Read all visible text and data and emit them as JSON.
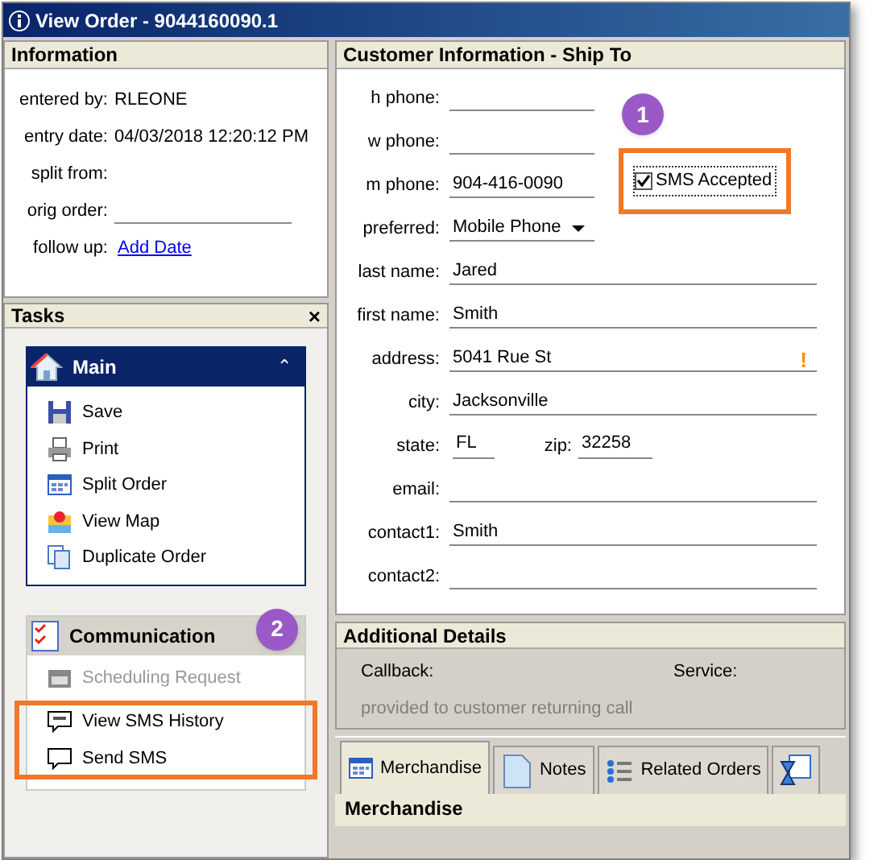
{
  "window": {
    "title": "View Order - 9044160090.1"
  },
  "information": {
    "title": "Information",
    "rows": [
      {
        "label": "entered by:",
        "value": "RLEONE",
        "kind": "text"
      },
      {
        "label": "entry date:",
        "value": "04/03/2018 12:20:12 PM",
        "kind": "text"
      },
      {
        "label": "split from:",
        "kind": "text"
      },
      {
        "label": "orig order:",
        "kind": "field"
      },
      {
        "label": "follow up:",
        "value": "Add Date",
        "kind": "link"
      }
    ]
  },
  "tasks": {
    "title": "Tasks",
    "close": "×",
    "main": {
      "title": "Main",
      "collapse": "⌃",
      "items": [
        {
          "label": "Save",
          "disabled": false
        },
        {
          "label": "Print",
          "disabled": false
        },
        {
          "label": "Split Order",
          "disabled": false
        },
        {
          "label": "View Map",
          "disabled": false
        },
        {
          "label": "Duplicate Order",
          "disabled": false
        }
      ]
    },
    "communication": {
      "title": "Communication",
      "items": [
        {
          "label": "Scheduling Request",
          "disabled": true,
          "highlighted": false
        },
        {
          "label": "View SMS History",
          "disabled": false,
          "highlighted": true
        },
        {
          "label": "Send SMS",
          "disabled": false,
          "highlighted": true
        }
      ]
    }
  },
  "customer": {
    "title": "Customer Information - Ship To",
    "rows": [
      {
        "kind": "phone",
        "label": "h phone:"
      },
      {
        "kind": "phone",
        "label": "w phone:"
      },
      {
        "kind": "phone",
        "label": "m phone:",
        "value": "904-416-0090"
      },
      {
        "kind": "select",
        "label": "preferred:",
        "value": "Mobile Phone"
      },
      {
        "kind": "field",
        "label": "last name:",
        "value": "Jared"
      },
      {
        "kind": "field",
        "label": "first name:",
        "value": "Smith"
      },
      {
        "kind": "field",
        "label": "address:",
        "value": "5041 Rue St",
        "warning": "!"
      },
      {
        "kind": "field",
        "label": "city:",
        "value": "Jacksonville"
      },
      {
        "kind": "pair",
        "label": "state:",
        "value": "FL",
        "label2": "zip:",
        "value2": "32258"
      },
      {
        "kind": "field",
        "label": "email:"
      },
      {
        "kind": "field",
        "label": "contact1:",
        "value": "Smith"
      },
      {
        "kind": "field",
        "label": "contact2:"
      }
    ],
    "sms": {
      "label": "SMS Accepted",
      "checked": true,
      "highlighted": true
    }
  },
  "additional": {
    "title": "Additional Details",
    "callback": "Callback:",
    "service": "Service:",
    "note": "provided to customer returning call"
  },
  "tabs": [
    {
      "label": "Merchandise",
      "selected": true
    },
    {
      "label": "Notes",
      "selected": false
    },
    {
      "label": "Related Orders",
      "selected": false
    },
    {
      "selected": false
    }
  ],
  "merchandise": {
    "title": "Merchandise"
  },
  "callouts": [
    {
      "number": "1"
    },
    {
      "number": "2"
    }
  ]
}
